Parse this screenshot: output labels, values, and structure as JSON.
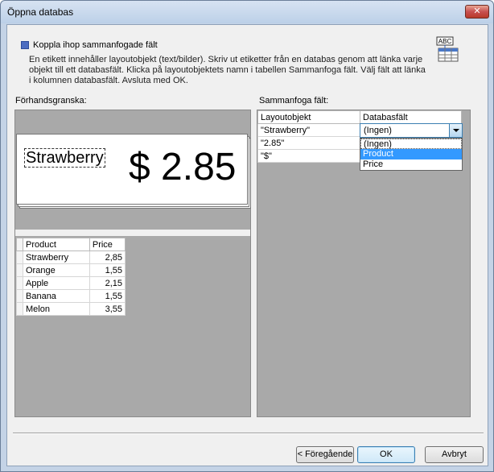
{
  "window": {
    "title": "Öppna databas",
    "close_label": "✕"
  },
  "section": {
    "title": "Koppla ihop sammanfogade fält",
    "icon": "abc-table-icon",
    "icon_text": "ABC",
    "description_lines": [
      "En etikett innehåller layoutobjekt (text/bilder). Skriv ut etiketter från en databas genom att länka varje",
      "objekt till ett databasfält. Klicka på layoutobjektets namn i tabellen Sammanfoga fält. Välj fält att länka",
      "i kolumnen databasfält. Avsluta med OK."
    ]
  },
  "preview": {
    "label": "Förhandsgranska:",
    "label_name": "Strawberry",
    "label_price": "$ 2.85"
  },
  "data_table": {
    "columns": [
      "Product",
      "Price"
    ],
    "rows": [
      [
        "Strawberry",
        "2,85"
      ],
      [
        "Orange",
        "1,55"
      ],
      [
        "Apple",
        "2,15"
      ],
      [
        "Banana",
        "1,55"
      ],
      [
        "Melon",
        "3,55"
      ]
    ]
  },
  "merge": {
    "label": "Sammanfoga fält:",
    "columns": [
      "Layoutobjekt",
      "Databasfält"
    ],
    "rows": [
      "\"Strawberry\"",
      "\"2.85\"",
      "\"$\""
    ],
    "combo_value": "(Ingen)",
    "dropdown_options": [
      "(Ingen)",
      "Product",
      "Price"
    ],
    "selected_option": "Product"
  },
  "buttons": {
    "previous": "< Föregående",
    "ok": "OK",
    "cancel": "Avbryt"
  },
  "colors": {
    "selection": "#3399ff",
    "preview_bg": "#a9a9a9",
    "section_square": "#4d6dc1"
  }
}
